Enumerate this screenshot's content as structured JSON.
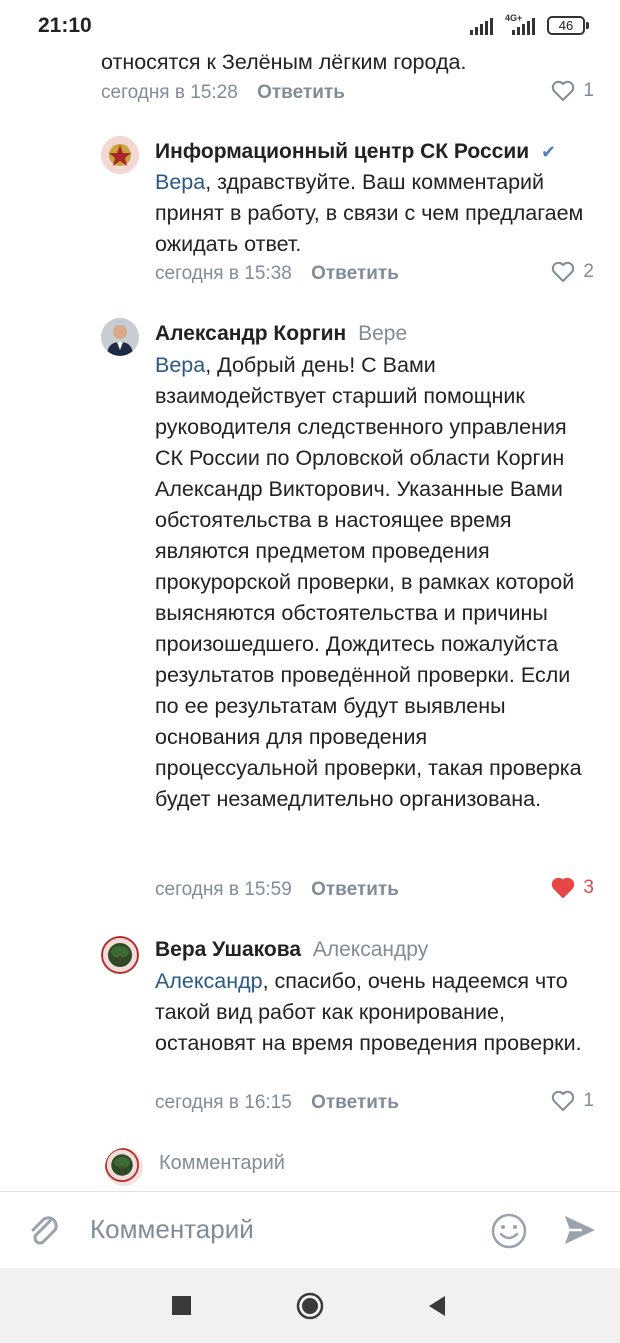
{
  "status_bar": {
    "time": "21:10",
    "network": "4G+",
    "battery": "46"
  },
  "comments": [
    {
      "text_tail": "относятся к Зелёным лёгким города.",
      "date": "сегодня в 15:28",
      "reply_label": "Ответить",
      "likes": "1",
      "liked": false
    },
    {
      "author": "Информационный центр СК России",
      "verified": true,
      "mention": "Вера",
      "text": ", здравствуйте. Ваш комментарий принят в работу, в связи с чем предлагаем ожидать ответ.",
      "date": "сегодня в 15:38",
      "reply_label": "Ответить",
      "likes": "2",
      "liked": false
    },
    {
      "author": "Александр Коргин",
      "reply_to": "Вере",
      "mention": "Вера",
      "text": ", Добрый день! С Вами взаимодействует старший помощник руководителя следственного управления СК России по Орловской области Коргин Александр Викторович. Указанные Вами обстоятельства в настоящее время являются предметом проведения прокурорской проверки, в рамках которой выясняются обстоятельства и причины произошедшего. Дождитесь пожалуйста результатов проведённой проверки. Если по ее результатам будут выявлены основания для проведения процессуальной проверки, такая проверка будет незамедлительно организована.",
      "date": "сегодня в 15:59",
      "reply_label": "Ответить",
      "likes": "3",
      "liked": true
    },
    {
      "author": "Вера Ушакова",
      "reply_to": "Александру",
      "mention": "Александр",
      "text": ", спасибо, очень надеемся что такой вид работ как кронирование, остановят на время проведения проверки.",
      "date": "сегодня в 16:15",
      "reply_label": "Ответить",
      "likes": "1",
      "liked": false
    }
  ],
  "reply_box": {
    "placeholder": "Комментарий"
  },
  "composer": {
    "placeholder": "Комментарий",
    "icons": [
      "attach-icon",
      "emoji-icon",
      "send-icon"
    ]
  },
  "nav_bar": {
    "icons": [
      "recents-square-icon",
      "home-circle-icon",
      "back-triangle-icon"
    ]
  },
  "colors": {
    "link": "#2a5885",
    "meta": "#818c99",
    "liked": "#e64646",
    "verified": "#5181b8"
  }
}
